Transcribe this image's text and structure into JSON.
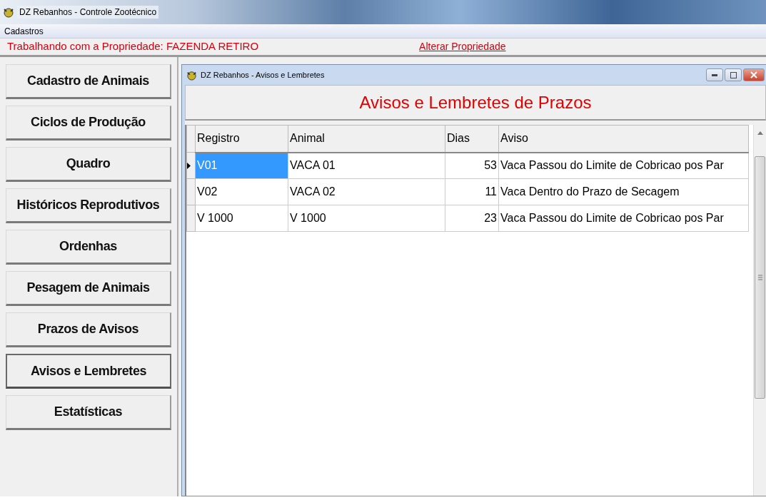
{
  "window": {
    "title": "DZ Rebanhos - Controle Zootécnico"
  },
  "menu": [
    "Cadastros"
  ],
  "property_bar": {
    "text": "Trabalhando com a Propriedade: FAZENDA RETIRO",
    "link": "Alterar Propriedade"
  },
  "sidebar": {
    "items": [
      {
        "label": "Cadastro de Animais",
        "selected": false
      },
      {
        "label": "Ciclos de Produção",
        "selected": false
      },
      {
        "label": "Quadro",
        "selected": false
      },
      {
        "label": "Históricos Reprodutivos",
        "selected": false
      },
      {
        "label": "Ordenhas",
        "selected": false
      },
      {
        "label": "Pesagem de Animais",
        "selected": false
      },
      {
        "label": "Prazos de Avisos",
        "selected": false
      },
      {
        "label": "Avisos e Lembretes",
        "selected": true
      },
      {
        "label": "Estatísticas",
        "selected": false
      }
    ]
  },
  "child_window": {
    "title": "DZ Rebanhos - Avisos e Lembretes",
    "heading": "Avisos e Lembretes de Prazos",
    "table": {
      "columns": [
        "Registro",
        "Animal",
        "Dias",
        "Aviso"
      ],
      "rows": [
        {
          "cells": [
            "V01",
            "VACA 01",
            "53",
            "Vaca Passou do Limite de Cobricao pos Par"
          ],
          "selected": true
        },
        {
          "cells": [
            "V02",
            "VACA 02",
            "11",
            "Vaca Dentro do Prazo de Secagem"
          ],
          "selected": false
        },
        {
          "cells": [
            "V 1000",
            "V 1000",
            "23",
            "Vaca Passou do Limite de Cobricao pos Par"
          ],
          "selected": false
        }
      ]
    }
  }
}
